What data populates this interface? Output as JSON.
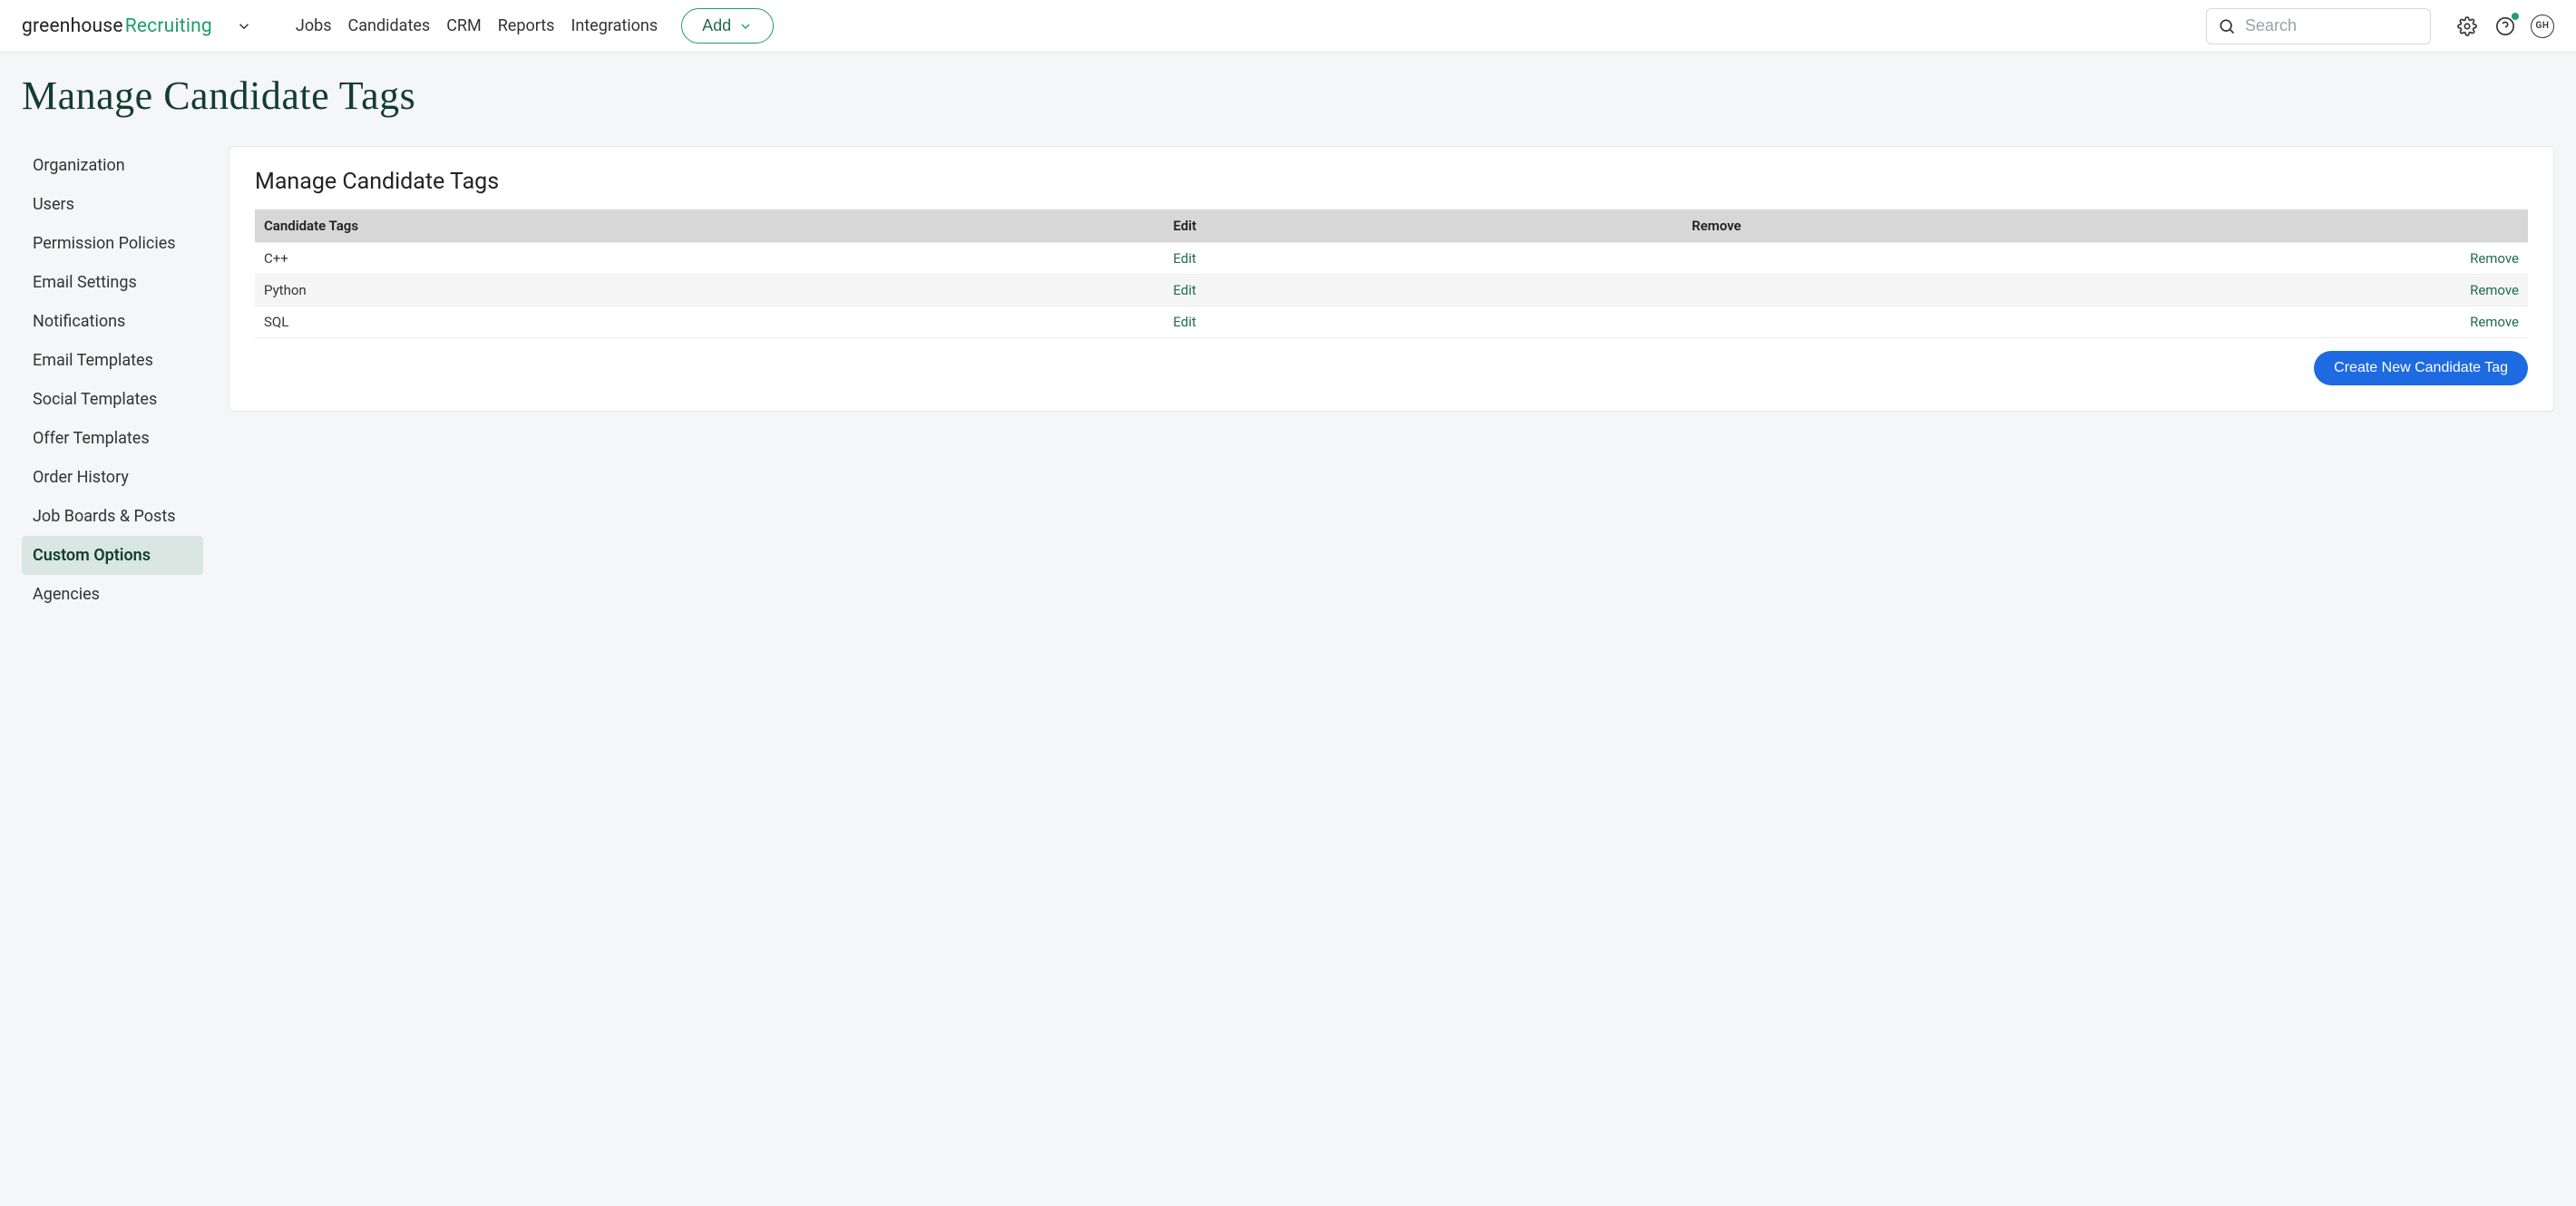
{
  "brand": {
    "word1": "greenhouse",
    "word2": "Recruiting"
  },
  "nav": {
    "jobs": "Jobs",
    "candidates": "Candidates",
    "crm": "CRM",
    "reports": "Reports",
    "integrations": "Integrations"
  },
  "add_label": "Add",
  "search": {
    "placeholder": "Search"
  },
  "avatar_initials": "GH",
  "page_title": "Manage Candidate Tags",
  "sidebar": {
    "items": [
      {
        "label": "Organization",
        "active": false
      },
      {
        "label": "Users",
        "active": false
      },
      {
        "label": "Permission Policies",
        "active": false
      },
      {
        "label": "Email Settings",
        "active": false
      },
      {
        "label": "Notifications",
        "active": false
      },
      {
        "label": "Email Templates",
        "active": false
      },
      {
        "label": "Social Templates",
        "active": false
      },
      {
        "label": "Offer Templates",
        "active": false
      },
      {
        "label": "Order History",
        "active": false
      },
      {
        "label": "Job Boards & Posts",
        "active": false
      },
      {
        "label": "Custom Options",
        "active": true
      },
      {
        "label": "Agencies",
        "active": false
      }
    ]
  },
  "panel": {
    "title": "Manage Candidate Tags",
    "columns": {
      "name": "Candidate Tags",
      "edit": "Edit",
      "remove": "Remove"
    },
    "actions": {
      "edit": "Edit",
      "remove": "Remove"
    },
    "rows": [
      {
        "name": "C++"
      },
      {
        "name": "Python"
      },
      {
        "name": "SQL"
      }
    ],
    "create_label": "Create New Candidate Tag"
  }
}
